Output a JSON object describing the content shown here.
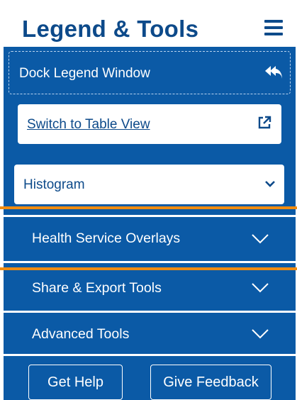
{
  "header": {
    "title": "Legend & Tools",
    "menu_icon": "hamburger-menu-icon"
  },
  "dock": {
    "label": "Dock Legend Window",
    "icon": "reply-all-icon"
  },
  "switch_view": {
    "label": "Switch to Table View",
    "icon": "external-link-icon"
  },
  "chart_select": {
    "selected": "Histogram",
    "icon": "chevron-down-icon"
  },
  "sections": [
    {
      "label": "Health Service Overlays",
      "expanded": false
    },
    {
      "label": "Share & Export Tools",
      "expanded": false
    },
    {
      "label": "Advanced Tools",
      "expanded": false
    }
  ],
  "footer": {
    "help_label": "Get Help",
    "feedback_label": "Give Feedback"
  },
  "colors": {
    "brand_blue": "#0b5aa6",
    "title_blue": "#0d4a8a",
    "highlight_orange": "#f08c11",
    "white": "#ffffff"
  }
}
